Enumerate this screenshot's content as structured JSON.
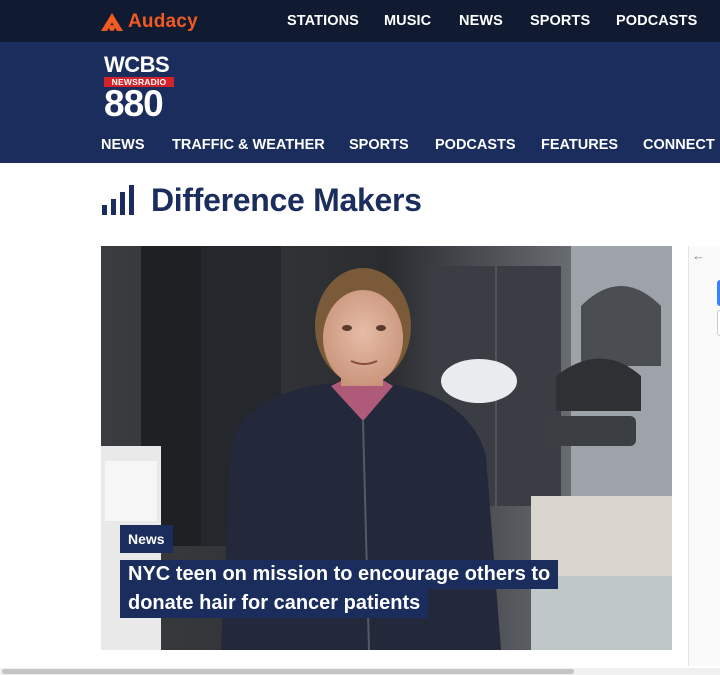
{
  "network": {
    "brand": "Audacy",
    "brand_color": "#f15a22",
    "nav": [
      "STATIONS",
      "MUSIC",
      "NEWS",
      "SPORTS",
      "PODCASTS"
    ]
  },
  "station": {
    "call_letters": "WCBS",
    "band_label": "NEWSRADIO",
    "frequency": "880",
    "nav": [
      "NEWS",
      "TRAFFIC & WEATHER",
      "SPORTS",
      "PODCASTS",
      "FEATURES",
      "CONNECT"
    ]
  },
  "section": {
    "title": "Difference Makers",
    "icon": "signal-bars-icon"
  },
  "featured": {
    "category": "News",
    "headline_lines": [
      "NYC teen on mission to encourage others to",
      "donate hair for cancer patients"
    ]
  },
  "carousel": {
    "prev_icon": "arrow-left-icon"
  },
  "colors": {
    "topbar": "#101a30",
    "station_header": "#1a2d5c",
    "accent_red": "#d4232b"
  }
}
